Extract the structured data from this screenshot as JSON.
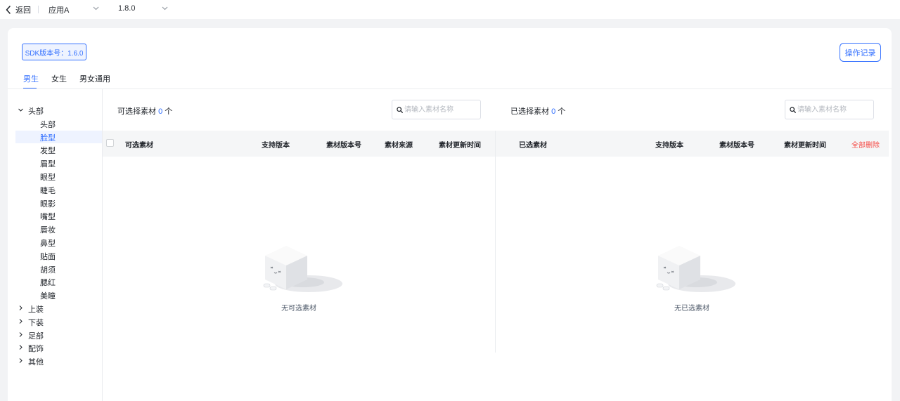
{
  "topbar": {
    "back_label": "返回",
    "app_select": {
      "value": "应用A"
    },
    "version_select": {
      "value": "1.8.0"
    }
  },
  "sdk_badge": "SDK版本号：1.6.0",
  "log_button": "操作记录",
  "tabs": [
    {
      "label": "男生",
      "active": true
    },
    {
      "label": "女生",
      "active": false
    },
    {
      "label": "男女通用",
      "active": false
    }
  ],
  "tree": {
    "head": {
      "label": "头部",
      "expanded": true,
      "children": [
        "头部",
        "脸型",
        "发型",
        "眉型",
        "眼型",
        "睫毛",
        "眼影",
        "嘴型",
        "唇妆",
        "鼻型",
        "贴面",
        "胡须",
        "腮红",
        "美瞳"
      ],
      "selected": "脸型"
    },
    "collapsed": [
      "上装",
      "下装",
      "足部",
      "配饰",
      "其他"
    ]
  },
  "left_panel": {
    "title": "可选择素材",
    "count": "0",
    "unit": "个",
    "search_placeholder": "请输入素材名称",
    "columns": [
      "可选素材",
      "支持版本",
      "素材版本号",
      "素材来源",
      "素材更新时间"
    ],
    "empty_text": "无可选素材"
  },
  "right_panel": {
    "title": "已选择素材",
    "count": "0",
    "unit": "个",
    "search_placeholder": "请输入素材名称",
    "columns": [
      "已选素材",
      "支持版本",
      "素材版本号",
      "素材更新时间"
    ],
    "clear_all": "全部删除",
    "empty_text": "无已选素材"
  },
  "colors": {
    "accent": "#3370ff",
    "danger": "#f54a45",
    "text": "#1f2329",
    "muted": "#b4b8bf"
  }
}
